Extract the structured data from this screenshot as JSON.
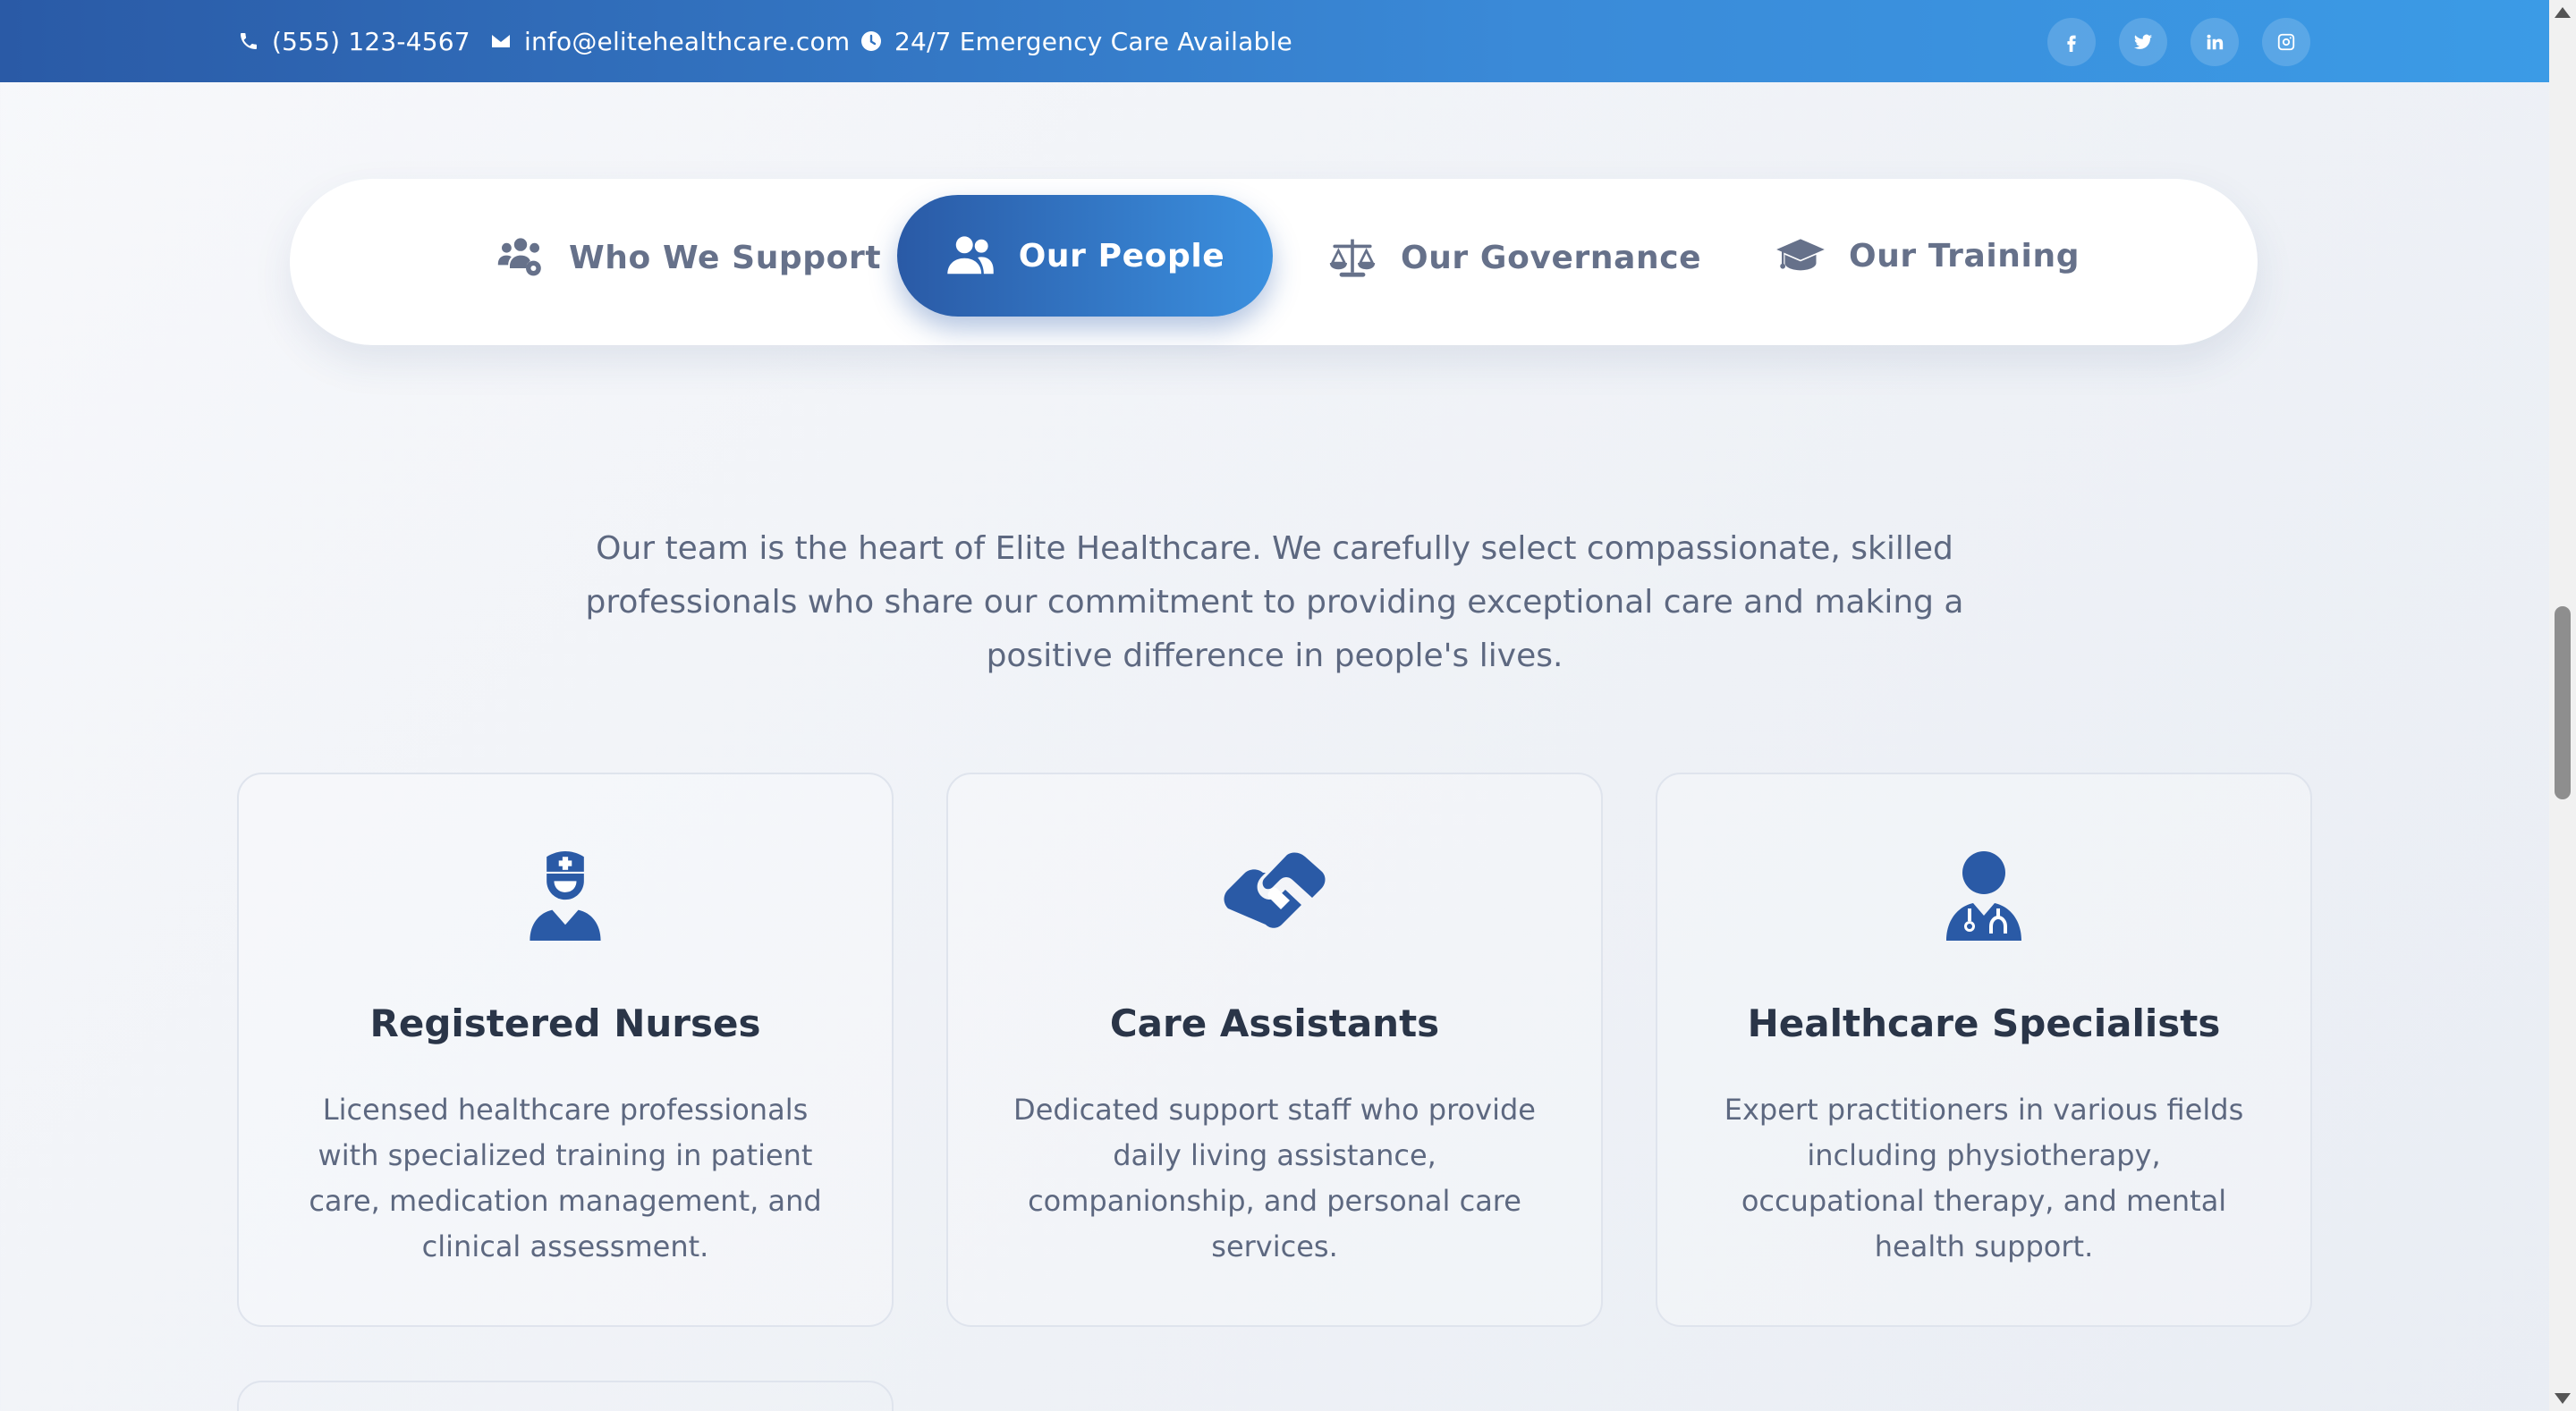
{
  "topbar": {
    "phone": "(555) 123-4567",
    "email": "info@elitehealthcare.com",
    "emergency": "24/7 Emergency Care Available",
    "social": [
      {
        "name": "facebook-icon",
        "glyph": "f"
      },
      {
        "name": "twitter-icon",
        "glyph": ""
      },
      {
        "name": "linkedin-icon",
        "glyph": "in"
      },
      {
        "name": "instagram-icon",
        "glyph": ""
      }
    ]
  },
  "tabs": [
    {
      "label": "Who We Support",
      "icon": "users-cog-icon",
      "active": false
    },
    {
      "label": "Our People",
      "icon": "users-icon",
      "active": true
    },
    {
      "label": "Our Governance",
      "icon": "balance-scale-icon",
      "active": false
    },
    {
      "label": "Our Training",
      "icon": "graduation-cap-icon",
      "active": false
    }
  ],
  "intro": "Our team is the heart of Elite Healthcare. We carefully select compassionate, skilled professionals who share our commitment to providing exceptional care and making a positive difference in people's lives.",
  "cards": [
    {
      "title": "Registered Nurses",
      "icon": "nurse-icon",
      "description": "Licensed healthcare professionals with specialized training in patient care, medication management, and clinical assessment."
    },
    {
      "title": "Care Assistants",
      "icon": "hands-helping-icon",
      "description": "Dedicated support staff who provide daily living assistance, companionship, and personal care services."
    },
    {
      "title": "Healthcare Specialists",
      "icon": "doctor-icon",
      "description": "Expert practitioners in various fields including physiotherapy, occupational therapy, and mental health support."
    }
  ],
  "colors": {
    "brand": "#2a5aa6",
    "brand_light": "#3b9be6",
    "text_muted": "#5d6880",
    "heading": "#2a3548"
  }
}
